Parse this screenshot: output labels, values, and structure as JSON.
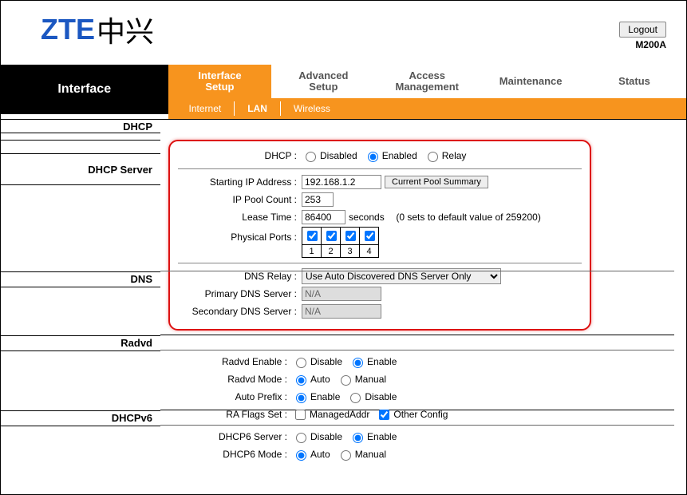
{
  "header": {
    "brand_en": "ZTE",
    "brand_cn": "中兴",
    "logout": "Logout",
    "model": "M200A"
  },
  "nav": {
    "page_title": "Interface",
    "tabs": {
      "interface_setup_l1": "Interface",
      "interface_setup_l2": "Setup",
      "advanced_l1": "Advanced",
      "advanced_l2": "Setup",
      "access_l1": "Access",
      "access_l2": "Management",
      "maintenance": "Maintenance",
      "status": "Status"
    },
    "subtabs": {
      "internet": "Internet",
      "lan": "LAN",
      "wireless": "Wireless"
    }
  },
  "sections": {
    "dhcp": "DHCP",
    "dhcp_server": "DHCP Server",
    "dns": "DNS",
    "radvd": "Radvd",
    "dhcpv6": "DHCPv6"
  },
  "dhcp": {
    "label": "DHCP :",
    "disabled": "Disabled",
    "enabled": "Enabled",
    "relay": "Relay"
  },
  "dhcp_server": {
    "starting_ip_label": "Starting IP Address :",
    "starting_ip": "192.168.1.2",
    "pool_summary_btn": "Current Pool Summary",
    "ip_pool_count_label": "IP Pool Count :",
    "ip_pool_count": "253",
    "lease_time_label": "Lease Time :",
    "lease_time": "86400",
    "lease_unit": "seconds",
    "lease_note": "(0 sets to default value of 259200)",
    "physical_ports_label": "Physical Ports :",
    "ports": {
      "p1": "1",
      "p2": "2",
      "p3": "3",
      "p4": "4"
    }
  },
  "dns": {
    "relay_label": "DNS Relay :",
    "relay_value": "Use Auto Discovered DNS Server Only",
    "primary_label": "Primary DNS Server :",
    "primary_value": "N/A",
    "secondary_label": "Secondary DNS Server :",
    "secondary_value": "N/A"
  },
  "radvd": {
    "enable_label": "Radvd Enable :",
    "mode_label": "Radvd Mode :",
    "auto_prefix_label": "Auto Prefix :",
    "ra_flags_label": "RA Flags Set :",
    "disable": "Disable",
    "enable": "Enable",
    "auto": "Auto",
    "manual": "Manual",
    "managed_addr": "ManagedAddr",
    "other_config": "Other Config"
  },
  "dhcpv6": {
    "server_label": "DHCP6 Server :",
    "mode_label": "DHCP6 Mode :",
    "disable": "Disable",
    "enable": "Enable",
    "auto": "Auto",
    "manual": "Manual"
  }
}
